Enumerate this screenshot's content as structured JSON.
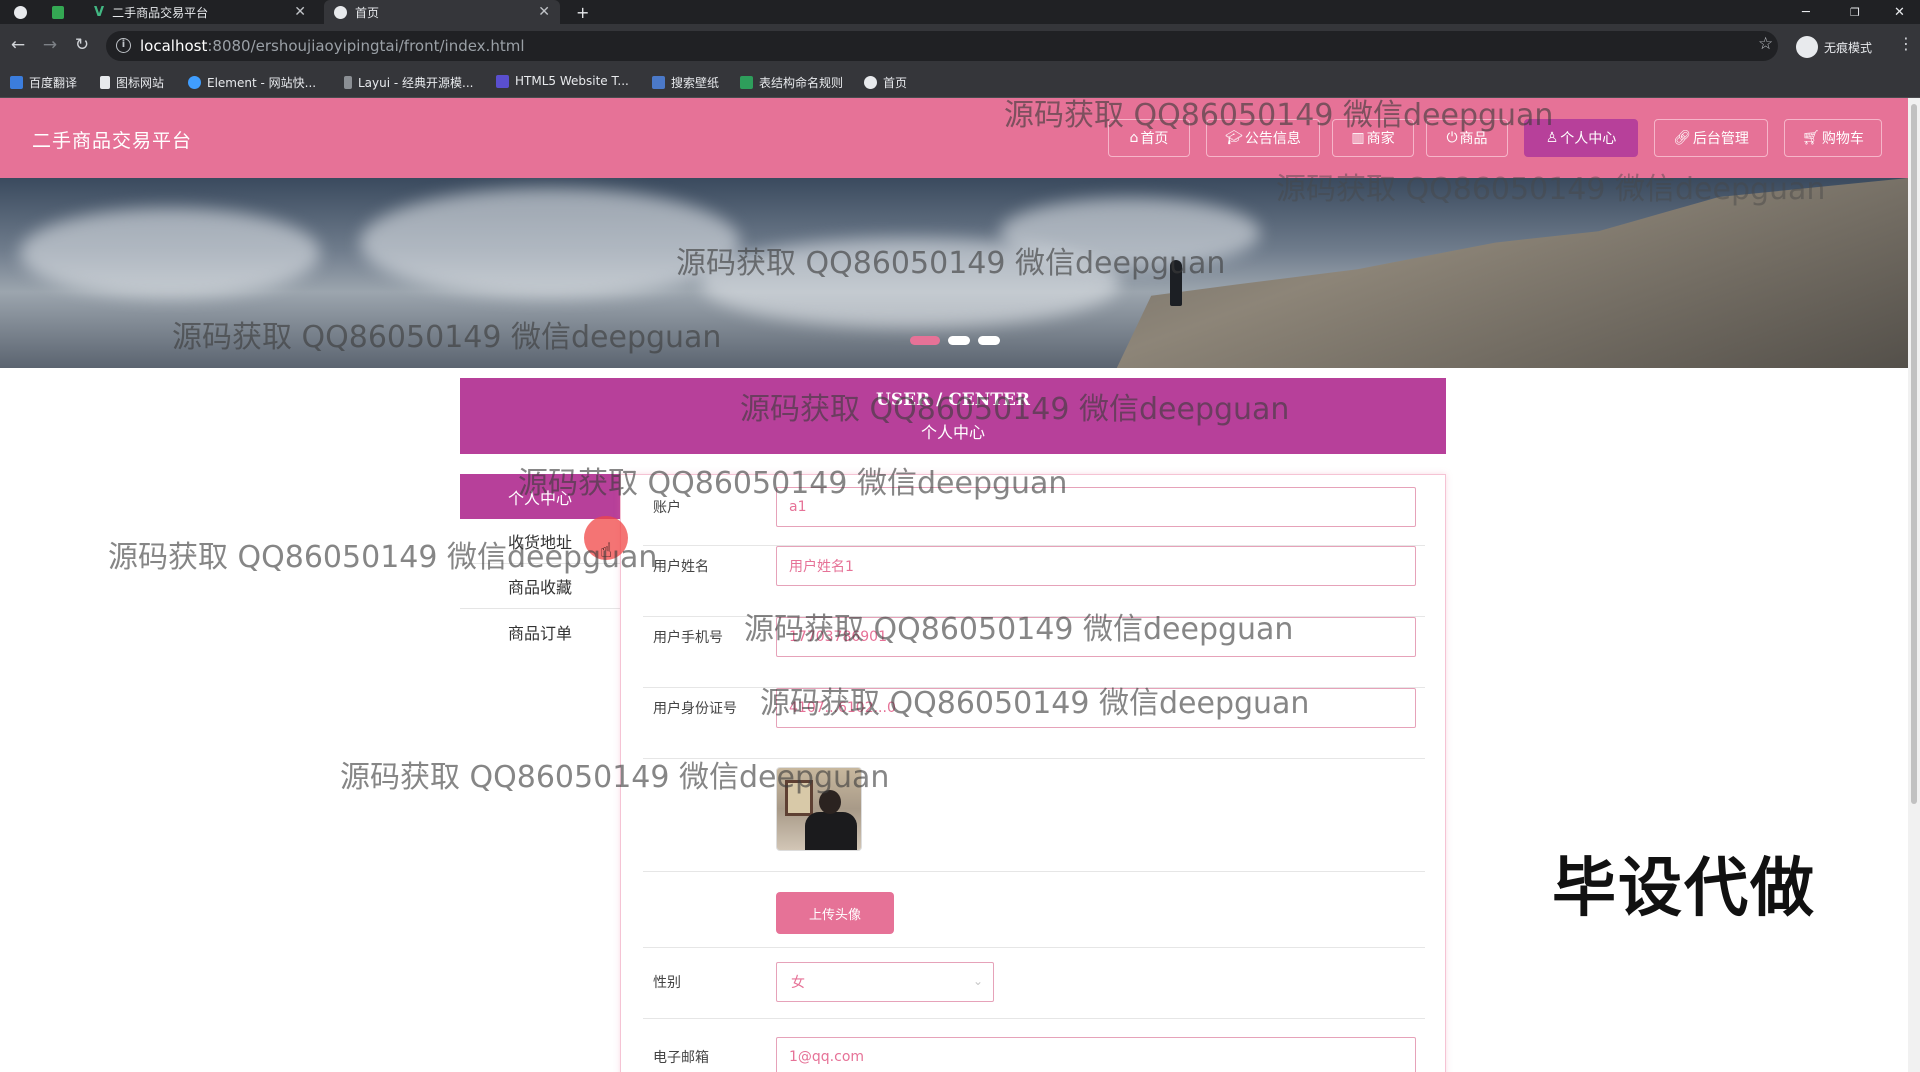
{
  "browser": {
    "tabs": [
      {
        "title": "二手商品交易平台"
      },
      {
        "title": "首页"
      }
    ],
    "new_tab_symbol": "+",
    "url_host": "localhost",
    "url_path": ":8080/ershoujiaoyipingtai/front/index.html",
    "profile_label": "无痕模式",
    "bookmarks": [
      "百度翻译",
      "图标网站",
      "Element - 网站快...",
      "Layui - 经典开源模...",
      "HTML5 Website T...",
      "搜索壁纸",
      "表结构命名规则",
      "首页"
    ]
  },
  "site": {
    "title": "二手商品交易平台",
    "nav": [
      {
        "label": "首页",
        "icon": "home-icon"
      },
      {
        "label": "公告信息",
        "icon": "graduation-cap-icon"
      },
      {
        "label": "商家",
        "icon": "store-icon"
      },
      {
        "label": "商品",
        "icon": "power-icon"
      },
      {
        "label": "个人中心",
        "icon": "user-icon",
        "active": true
      },
      {
        "label": "后台管理",
        "icon": "link-icon"
      },
      {
        "label": "购物车",
        "icon": "cart-icon"
      }
    ],
    "banner_slides": 3,
    "banner_active_slide": 1
  },
  "user_center": {
    "title_en": "USER / CENTER",
    "title_zh": "个人中心",
    "side_menu": [
      {
        "label": "个人中心",
        "active": true
      },
      {
        "label": "收货地址"
      },
      {
        "label": "商品收藏"
      },
      {
        "label": "商品订单"
      }
    ]
  },
  "form": {
    "account": {
      "label": "账户",
      "value": "a1"
    },
    "name": {
      "label": "用户姓名",
      "value": "用户姓名1"
    },
    "phone": {
      "label": "用户手机号",
      "value": "17703786901"
    },
    "id_card": {
      "label": "用户身份证号",
      "value": "4107...6102...0"
    },
    "avatar_alt": "用户头像",
    "upload_label": "上传头像",
    "gender": {
      "label": "性别",
      "value": "女"
    },
    "email": {
      "label": "电子邮箱",
      "value": "1@qq.com"
    }
  },
  "overlay": {
    "watermark": "源码获取 QQ86050149 微信deepguan",
    "corner_text": "毕设代做"
  },
  "colors": {
    "primary": "#e67297",
    "accent": "#b7409a"
  }
}
